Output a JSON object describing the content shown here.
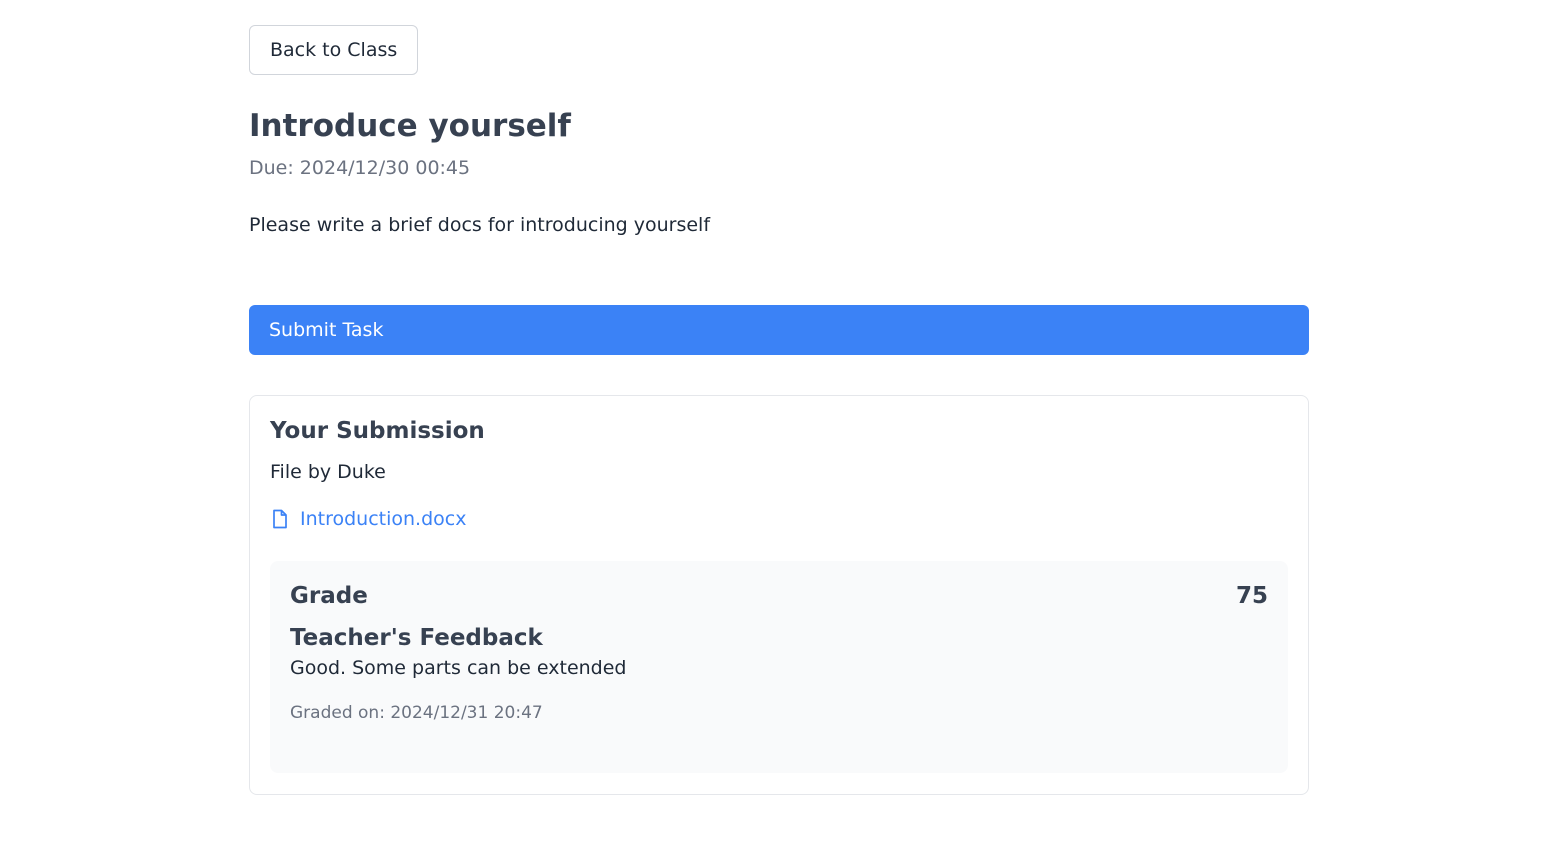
{
  "navigation": {
    "back_label": "Back to Class"
  },
  "task": {
    "title": "Introduce yourself",
    "due": "Due: 2024/12/30 00:45",
    "description": "Please write a brief docs for introducing yourself",
    "submit_label": "Submit Task"
  },
  "submission": {
    "heading": "Your Submission",
    "file_by": "File by Duke",
    "file_icon": "file-icon",
    "file_name": "Introduction.docx",
    "grade": {
      "label": "Grade",
      "value": "75",
      "feedback_heading": "Teacher's Feedback",
      "feedback_text": "Good. Some parts can be extended",
      "graded_on": "Graded on: 2024/12/31 20:47"
    }
  },
  "colors": {
    "accent": "#3b82f6",
    "text": "#374151",
    "muted": "#6b7280",
    "grade_background": "#f9fafb"
  }
}
